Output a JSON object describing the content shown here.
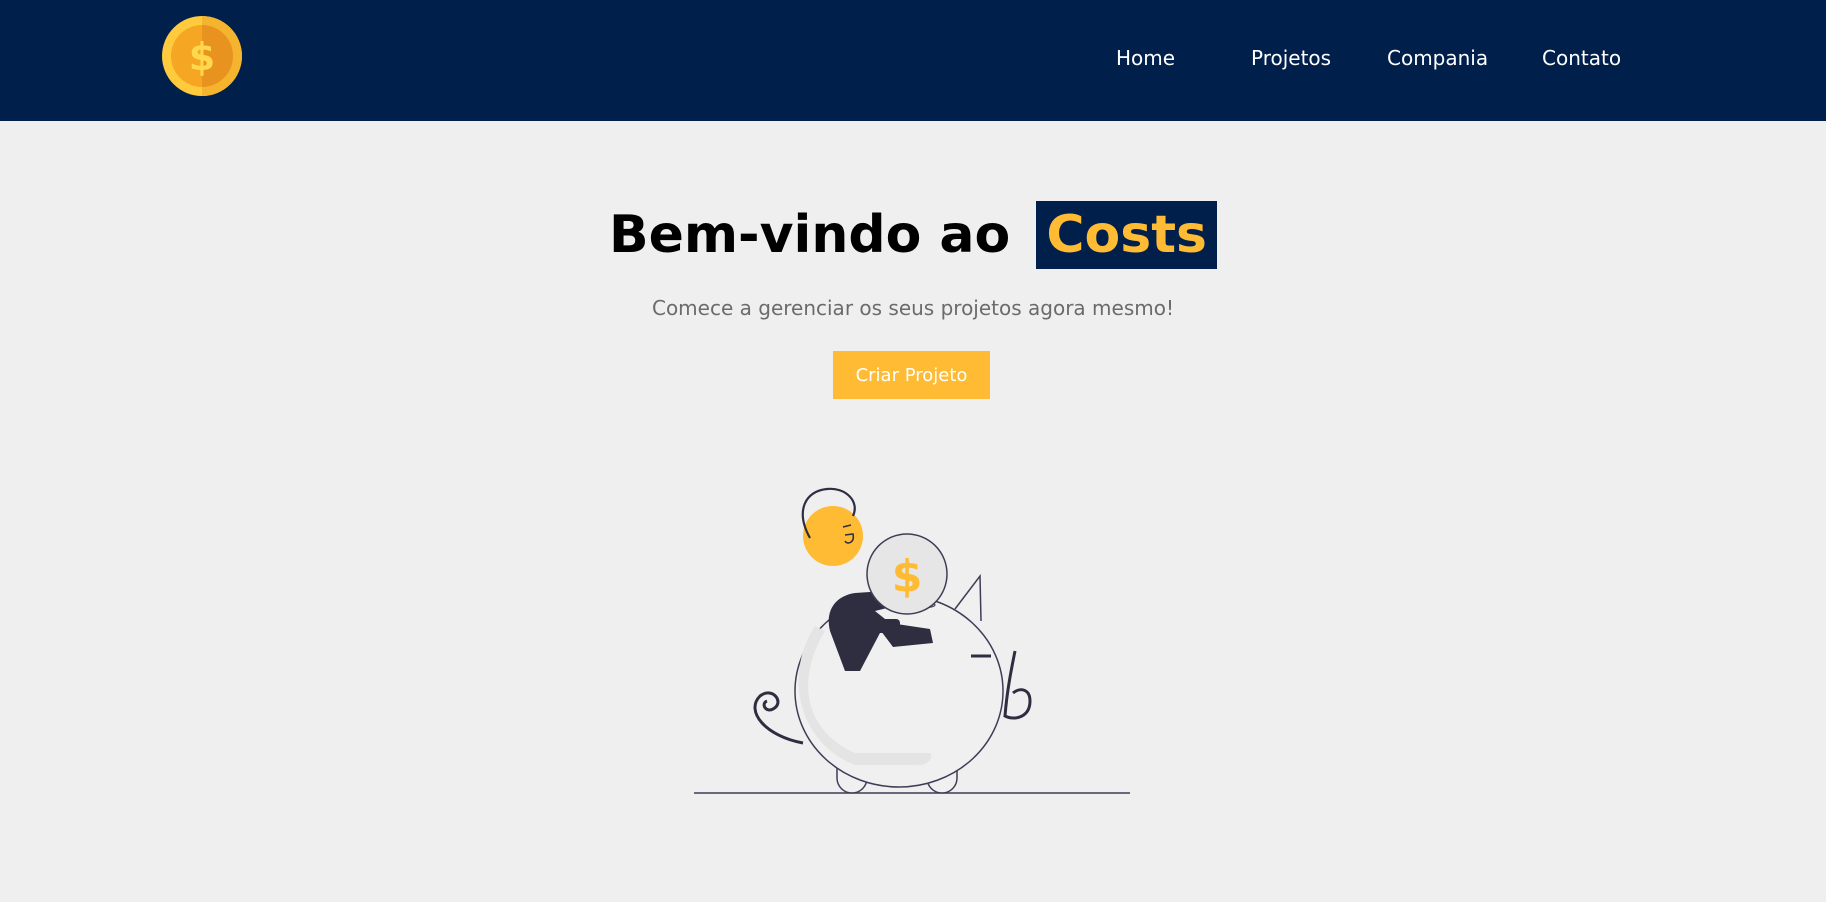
{
  "nav": {
    "logo_icon": "dollar-coin-icon",
    "items": [
      {
        "label": "Home"
      },
      {
        "label": "Projetos"
      },
      {
        "label": "Compania"
      },
      {
        "label": "Contato"
      }
    ]
  },
  "hero": {
    "title_prefix": "Bem-vindo ao",
    "title_brand": "Costs",
    "subtitle": "Comece a gerenciar os seus projetos agora mesmo!",
    "cta_label": "Criar Projeto",
    "illustration_icon": "piggy-bank-savings-illustration"
  },
  "colors": {
    "navbar": "#001f4a",
    "accent": "#ffbb33",
    "background": "#efefef"
  }
}
